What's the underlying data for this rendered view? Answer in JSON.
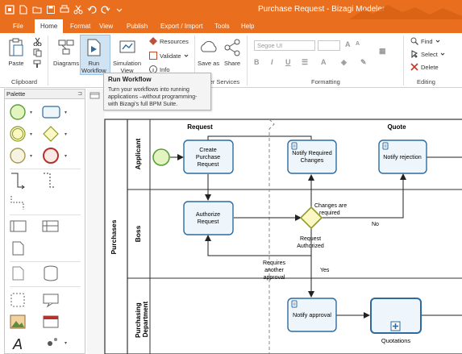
{
  "window": {
    "title": "Purchase Request - Bizagi Modeler"
  },
  "menu": {
    "tabs": [
      {
        "label": "File",
        "active": false
      },
      {
        "label": "Home",
        "active": true
      },
      {
        "label": "Format",
        "active": false
      },
      {
        "label": "View",
        "active": false
      },
      {
        "label": "Publish",
        "active": false
      },
      {
        "label": "Export / Import",
        "active": false
      },
      {
        "label": "Tools",
        "active": false
      },
      {
        "label": "Help",
        "active": false
      }
    ]
  },
  "ribbon": {
    "paste": "Paste",
    "clipboard_group": "Clipboard",
    "diagrams": "Diagrams",
    "run_workflow": "Run\nWorkflow",
    "simulation_view": "Simulation\nView",
    "resources": "Resources",
    "validate": "Validate",
    "info": "Info",
    "save_as": "Save as",
    "share": "Share",
    "services_group": "ier Services",
    "font_name": "Segoe UI",
    "formatting_group": "Formatting",
    "find": "Find",
    "select": "Select",
    "delete": "Delete",
    "editing_group": "Editing"
  },
  "tooltip": {
    "title": "Run Workflow",
    "body": "Turn your workflows into running applications –without programming- with Bizagi's full BPM Suite."
  },
  "palette": {
    "title": "Palette"
  },
  "diagram": {
    "pool": "Purchases",
    "lanes": [
      "Applicant",
      "Boss",
      "Purchasing Department"
    ],
    "milestones": [
      "Request",
      "Quote"
    ],
    "tasks": {
      "create": "Create Purchase Request",
      "authorize": "Authorize Request",
      "notify_changes": "Notify Required Changes",
      "notify_rejection": "Notify rejection",
      "notify_approval": "Notify approval",
      "quotations": "Quotations"
    },
    "gateway_label": "Request Authorized",
    "flows": {
      "changes_required": "Changes are required",
      "no": "No",
      "yes": "Yes",
      "requires_approval": "Requires another approval"
    }
  },
  "colors": {
    "accent": "#e96f1f",
    "task_fill": "#eef6fc",
    "task_stroke": "#2e6a9c",
    "gateway_fill": "#fbf8c4",
    "gateway_stroke": "#8f9a2a",
    "start_fill": "#e4f4c0",
    "start_stroke": "#5a9e3a"
  }
}
